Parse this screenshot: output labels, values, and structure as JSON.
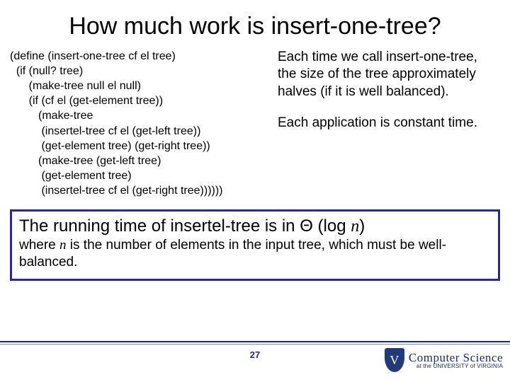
{
  "title": "How much work is insert-one-tree?",
  "code": "(define (insert-one-tree cf el tree)\n  (if (null? tree)\n      (make-tree null el null)\n      (if (cf el (get-element tree))\n         (make-tree\n          (insertel-tree cf el (get-left tree))\n          (get-element tree) (get-right tree))\n         (make-tree (get-left tree)\n          (get-element tree)\n          (insertel-tree cf el (get-right tree))))))",
  "explanation": {
    "p1": "Each time we call insert-one-tree, the size of the tree approximately halves (if it is well balanced).",
    "p2": "Each application is constant time."
  },
  "conclusion": {
    "line1_a": "The running time of insertel-tree is in ",
    "line1_theta": "Θ",
    "line1_b": " (log ",
    "line1_n": "n",
    "line1_c": ")",
    "line2_a": "where ",
    "line2_n": "n",
    "line2_b": " is the number of elements in the input tree, which must be well-balanced."
  },
  "page_number": "27",
  "logo": {
    "shield_letter": "V",
    "line1": "Computer Science",
    "line2": "at the UNIVERSITY of VIRGINIA"
  }
}
